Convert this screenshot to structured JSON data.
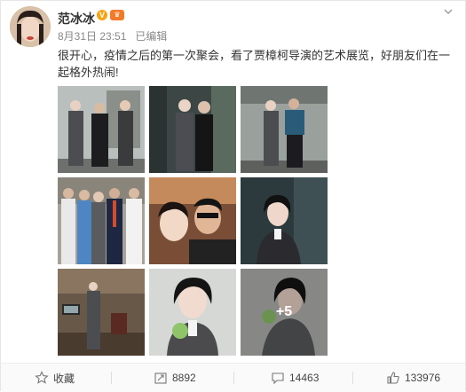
{
  "post": {
    "username": "范冰冰",
    "badge_icon": "verified-v-icon",
    "vip_icon": "vip-icon",
    "date": "8月31日 23:51",
    "edited": "已编辑",
    "content": "很开心，疫情之后的第一次聚会，看了贾樟柯导演的艺术展览，好朋友们在一起格外热闹!",
    "more_count": "+5"
  },
  "actions": {
    "favorite_label": "收藏",
    "repost_count": "8892",
    "comment_count": "14463",
    "like_count": "133976"
  },
  "colors": {
    "accent": "#f7a312",
    "vip": "#f27a28",
    "text_meta": "#888888"
  }
}
